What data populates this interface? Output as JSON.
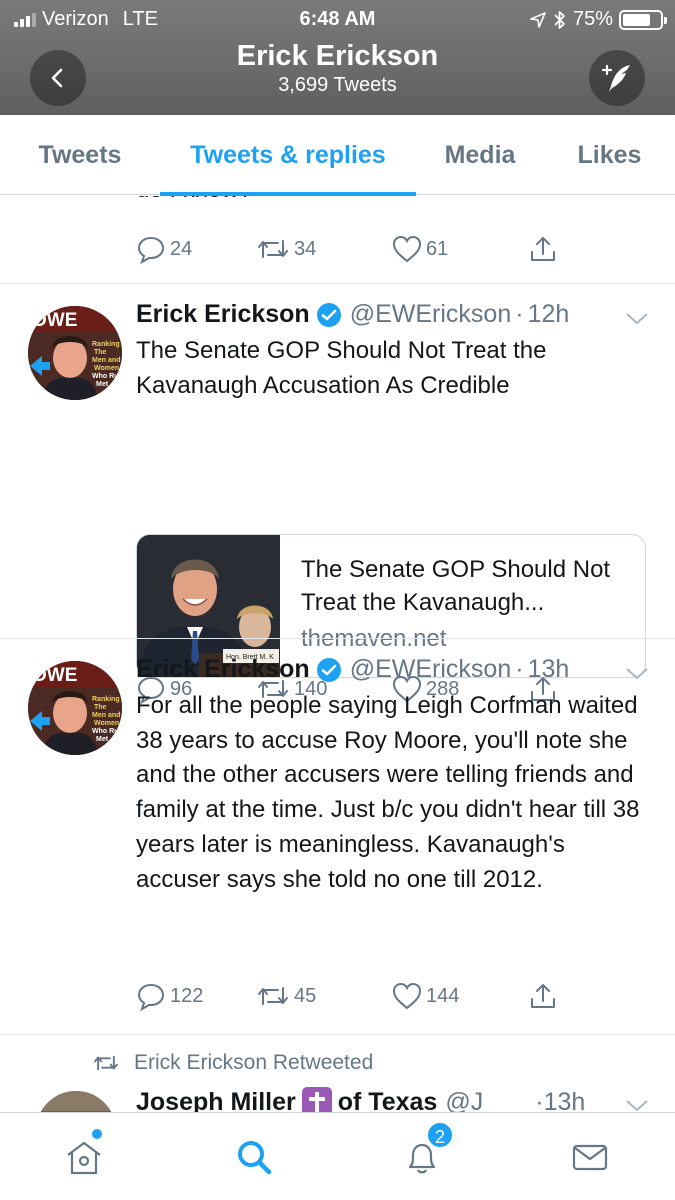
{
  "status_bar": {
    "carrier": "Verizon",
    "network": "LTE",
    "time": "6:48 AM",
    "battery": "75%",
    "battery_level": 0.75
  },
  "header": {
    "title": "Erick Erickson",
    "subtitle": "3,699 Tweets",
    "back_icon": "chevron-left-icon",
    "compose_icon": "compose-quill-icon"
  },
  "tabs": [
    {
      "label": "Tweets",
      "active": false
    },
    {
      "label": "Tweets & replies",
      "active": true
    },
    {
      "label": "Media",
      "active": false
    },
    {
      "label": "Likes",
      "active": false
    }
  ],
  "feed": {
    "cutoff_tweet": {
      "text_tail": "do I know?",
      "replies": "24",
      "retweets": "34",
      "likes": "61"
    },
    "tweets": [
      {
        "name": "Erick Erickson",
        "handle": "@EWErickson",
        "separator": "·",
        "time": "12h",
        "text": "The Senate GOP Should Not Treat the Kavanaugh Accusation As Credible",
        "card": {
          "title": "The Senate GOP Should Not Treat the Kavanaugh...",
          "domain": "themaven.net",
          "nameplate": "Hon. Brett M. K"
        },
        "replies": "96",
        "retweets": "140",
        "likes": "288"
      },
      {
        "name": "Erick Erickson",
        "handle": "@EWErickson",
        "separator": "·",
        "time": "13h",
        "text": "For all the people saying Leigh Corfman waited 38 years to accuse Roy Moore, you'll note she and the other accusers were telling friends and family at the time.  Just b/c you didn't hear till 38 years later is meaningless. Kavanaugh's accuser says she told no one till 2012.",
        "replies": "122",
        "retweets": "45",
        "likes": "144"
      }
    ],
    "retweet_row": {
      "label": "Erick Erickson Retweeted",
      "name_partial": "Joseph Miller",
      "name_suffix": "of Texas",
      "handle_partial": "@J",
      "time": "13h"
    }
  },
  "avatar_text": [
    "OWE",
    "Ranking",
    "The",
    "Men and",
    "Women",
    "Who Ru",
    "Met"
  ],
  "bottom_nav": {
    "notifications_badge": "2",
    "items": [
      "home-icon",
      "search-icon",
      "notifications-icon",
      "messages-icon"
    ]
  },
  "colors": {
    "accent": "#1da1f2",
    "secondary_text": "#657786",
    "verified": "#1da1f2",
    "header_bg": "#6e6e6e"
  }
}
